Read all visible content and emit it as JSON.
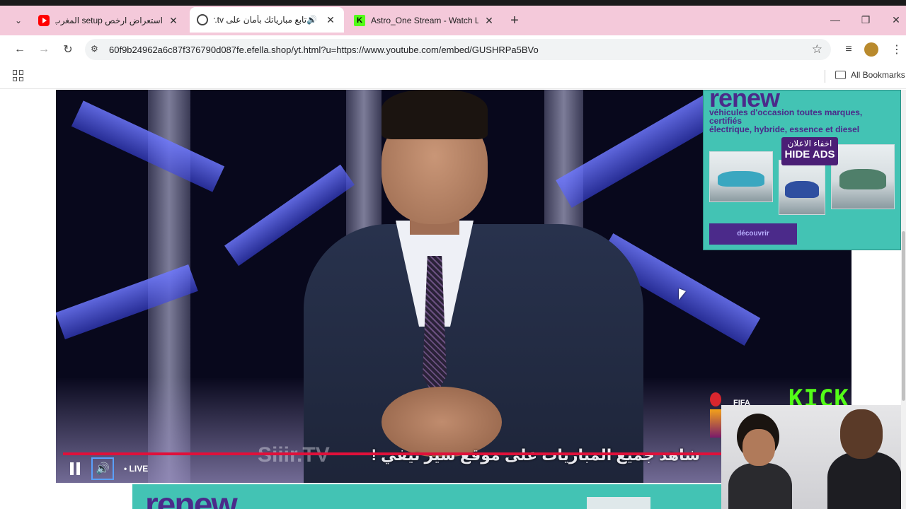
{
  "browser": {
    "tabs": [
      {
        "title": "استعراض ارخص setup المغرب  cr",
        "favicon": "youtube-icon",
        "active": false
      },
      {
        "title": "تابع مبارياتك بأمان على siir.tv",
        "favicon": "globe-icon",
        "active": true,
        "audio": true
      },
      {
        "title": "Astro_One Stream - Watch Live",
        "favicon": "kick-icon",
        "active": false
      }
    ],
    "new_tab": "+",
    "url": "60f9b24962a6c87f376790d087fe.efella.shop/yt.html?u=https://www.youtube.com/embed/GUSHRPa5BVo",
    "bookmarks_label": "All Bookmarks"
  },
  "video": {
    "ticker": "شاهد جميع المباريات على موقع سير تيفي !",
    "watermark": "Siiir.TV",
    "live_label": "LIVE",
    "kick_logo": "KICK",
    "fifa_text": "FIFA"
  },
  "ad_top": {
    "logo": "renew",
    "line1": "véhicules d'occasion toutes marques,",
    "line2": "certifiés",
    "line3": "électrique, hybride, essence et diesel",
    "hide_ar": "اخفاء الاعلان",
    "hide_en": "HIDE ADS",
    "cta": "découvrir"
  },
  "ad_bottom": {
    "logo": "renew"
  },
  "colors": {
    "tabstrip": "#f4c9da",
    "ad_teal": "#43c3b4",
    "ad_purple": "#4b2a8a",
    "progress_red": "#e0103a",
    "kick_green": "#53fc18"
  }
}
